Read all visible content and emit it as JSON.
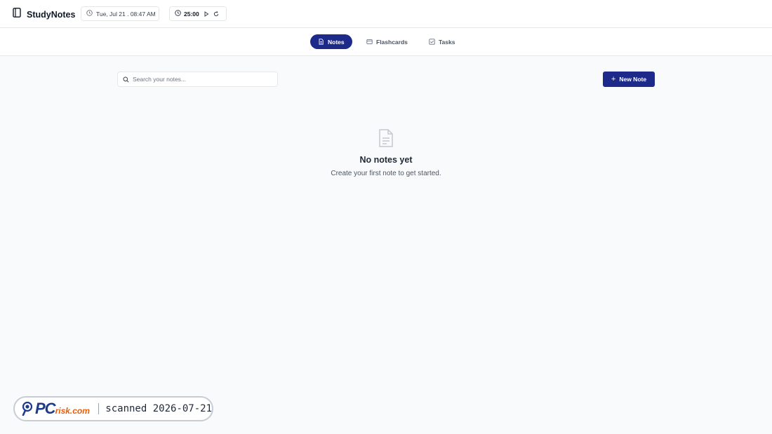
{
  "app": {
    "name": "StudyNotes"
  },
  "header": {
    "datetime": "Tue, Jul 21 . 08:47 AM",
    "timer": "25:00"
  },
  "tabs": [
    {
      "label": "Notes",
      "active": true
    },
    {
      "label": "Flashcards",
      "active": false
    },
    {
      "label": "Tasks",
      "active": false
    }
  ],
  "toolbar": {
    "search_placeholder": "Search your notes...",
    "new_note_label": "New Note"
  },
  "empty_state": {
    "title": "No notes yet",
    "subtitle": "Create your first note to get started."
  },
  "watermark": {
    "logo": "PCrisk.com",
    "stamp": "scanned 2026-07-21"
  },
  "colors": {
    "accent": "#1e2a8a",
    "background": "#f9fafb",
    "surface": "#ffffff"
  },
  "icons": [
    "notebook-icon",
    "clock-icon",
    "timer-icon",
    "play-icon",
    "reset-icon",
    "document-icon",
    "flashcard-icon",
    "checkbox-icon",
    "search-icon",
    "plus-icon",
    "empty-document-icon"
  ]
}
